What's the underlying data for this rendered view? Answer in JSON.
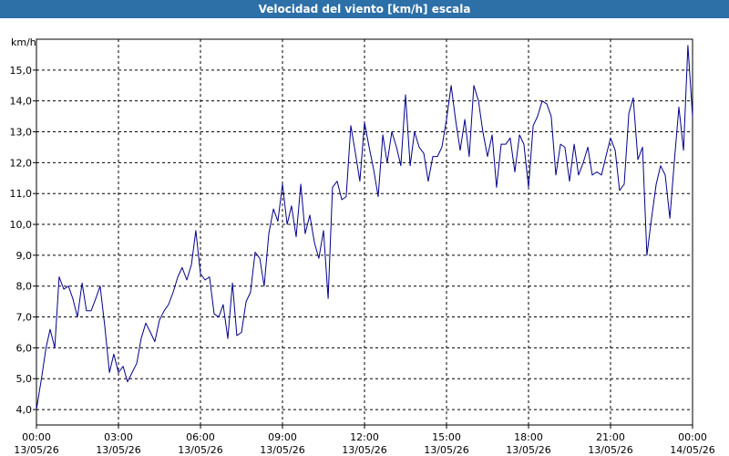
{
  "window": {
    "title": "Velocidad del viento [km/h] escala"
  },
  "chart_data": {
    "type": "line",
    "title": "Velocidad del viento [km/h] escala",
    "ylabel": "km/h",
    "xlabel": "",
    "ylim": [
      3.5,
      16.0
    ],
    "xlim_hours": [
      0,
      24
    ],
    "grid": true,
    "yticks": [
      {
        "value": 4.0,
        "label": "4,0"
      },
      {
        "value": 5.0,
        "label": "5,0"
      },
      {
        "value": 6.0,
        "label": "6,0"
      },
      {
        "value": 7.0,
        "label": "7,0"
      },
      {
        "value": 8.0,
        "label": "8,0"
      },
      {
        "value": 9.0,
        "label": "9,0"
      },
      {
        "value": 10.0,
        "label": "10,0"
      },
      {
        "value": 11.0,
        "label": "11,0"
      },
      {
        "value": 12.0,
        "label": "12,0"
      },
      {
        "value": 13.0,
        "label": "13,0"
      },
      {
        "value": 14.0,
        "label": "14,0"
      },
      {
        "value": 15.0,
        "label": "15,0"
      }
    ],
    "xticks": [
      {
        "hour": 0,
        "time": "00:00",
        "date": "13/05/26"
      },
      {
        "hour": 3,
        "time": "03:00",
        "date": "13/05/26"
      },
      {
        "hour": 6,
        "time": "06:00",
        "date": "13/05/26"
      },
      {
        "hour": 9,
        "time": "09:00",
        "date": "13/05/26"
      },
      {
        "hour": 12,
        "time": "12:00",
        "date": "13/05/26"
      },
      {
        "hour": 15,
        "time": "15:00",
        "date": "13/05/26"
      },
      {
        "hour": 18,
        "time": "18:00",
        "date": "13/05/26"
      },
      {
        "hour": 21,
        "time": "21:00",
        "date": "13/05/26"
      },
      {
        "hour": 24,
        "time": "00:00",
        "date": "14/05/26"
      }
    ],
    "series": [
      {
        "color": "#00008b",
        "points": [
          [
            0.0,
            4.0
          ],
          [
            0.2,
            5.1
          ],
          [
            0.35,
            6.0
          ],
          [
            0.5,
            6.6
          ],
          [
            0.67,
            6.0
          ],
          [
            0.83,
            8.3
          ],
          [
            1.0,
            7.9
          ],
          [
            1.17,
            8.0
          ],
          [
            1.33,
            7.6
          ],
          [
            1.5,
            7.0
          ],
          [
            1.67,
            8.1
          ],
          [
            1.83,
            7.2
          ],
          [
            2.0,
            7.2
          ],
          [
            2.17,
            7.6
          ],
          [
            2.33,
            8.0
          ],
          [
            2.5,
            6.7
          ],
          [
            2.67,
            5.2
          ],
          [
            2.83,
            5.8
          ],
          [
            3.0,
            5.2
          ],
          [
            3.17,
            5.4
          ],
          [
            3.33,
            4.9
          ],
          [
            3.5,
            5.2
          ],
          [
            3.67,
            5.5
          ],
          [
            3.83,
            6.3
          ],
          [
            4.0,
            6.8
          ],
          [
            4.17,
            6.5
          ],
          [
            4.33,
            6.2
          ],
          [
            4.5,
            6.9
          ],
          [
            4.67,
            7.2
          ],
          [
            4.83,
            7.4
          ],
          [
            5.0,
            7.8
          ],
          [
            5.17,
            8.3
          ],
          [
            5.33,
            8.6
          ],
          [
            5.5,
            8.2
          ],
          [
            5.67,
            8.7
          ],
          [
            5.83,
            9.8
          ],
          [
            6.0,
            8.4
          ],
          [
            6.17,
            8.2
          ],
          [
            6.33,
            8.3
          ],
          [
            6.5,
            7.1
          ],
          [
            6.67,
            7.0
          ],
          [
            6.83,
            7.4
          ],
          [
            7.0,
            6.3
          ],
          [
            7.17,
            8.1
          ],
          [
            7.33,
            6.4
          ],
          [
            7.5,
            6.5
          ],
          [
            7.67,
            7.5
          ],
          [
            7.83,
            7.8
          ],
          [
            8.0,
            9.1
          ],
          [
            8.17,
            8.9
          ],
          [
            8.33,
            8.0
          ],
          [
            8.5,
            9.7
          ],
          [
            8.67,
            10.5
          ],
          [
            8.83,
            10.1
          ],
          [
            9.0,
            11.3
          ],
          [
            9.17,
            10.0
          ],
          [
            9.33,
            10.6
          ],
          [
            9.5,
            9.6
          ],
          [
            9.67,
            11.3
          ],
          [
            9.83,
            9.7
          ],
          [
            10.0,
            10.3
          ],
          [
            10.17,
            9.4
          ],
          [
            10.33,
            8.9
          ],
          [
            10.5,
            9.8
          ],
          [
            10.67,
            7.6
          ],
          [
            10.83,
            11.2
          ],
          [
            11.0,
            11.4
          ],
          [
            11.17,
            10.8
          ],
          [
            11.33,
            10.9
          ],
          [
            11.5,
            13.2
          ],
          [
            11.67,
            12.3
          ],
          [
            11.83,
            11.4
          ],
          [
            12.0,
            13.3
          ],
          [
            12.17,
            12.5
          ],
          [
            12.33,
            11.8
          ],
          [
            12.5,
            10.9
          ],
          [
            12.67,
            12.9
          ],
          [
            12.83,
            12.0
          ],
          [
            13.0,
            13.0
          ],
          [
            13.17,
            12.5
          ],
          [
            13.33,
            11.9
          ],
          [
            13.5,
            14.2
          ],
          [
            13.67,
            11.9
          ],
          [
            13.83,
            13.0
          ],
          [
            14.0,
            12.5
          ],
          [
            14.17,
            12.3
          ],
          [
            14.33,
            11.4
          ],
          [
            14.5,
            12.2
          ],
          [
            14.67,
            12.2
          ],
          [
            14.83,
            12.5
          ],
          [
            15.0,
            13.4
          ],
          [
            15.17,
            14.5
          ],
          [
            15.33,
            13.4
          ],
          [
            15.5,
            12.4
          ],
          [
            15.67,
            13.4
          ],
          [
            15.83,
            12.2
          ],
          [
            16.0,
            14.5
          ],
          [
            16.17,
            14.0
          ],
          [
            16.33,
            13.0
          ],
          [
            16.5,
            12.2
          ],
          [
            16.67,
            12.9
          ],
          [
            16.83,
            11.2
          ],
          [
            17.0,
            12.6
          ],
          [
            17.17,
            12.6
          ],
          [
            17.33,
            12.8
          ],
          [
            17.5,
            11.7
          ],
          [
            17.67,
            12.9
          ],
          [
            17.83,
            12.6
          ],
          [
            18.0,
            11.2
          ],
          [
            18.17,
            13.2
          ],
          [
            18.33,
            13.5
          ],
          [
            18.5,
            14.0
          ],
          [
            18.67,
            13.9
          ],
          [
            18.83,
            13.5
          ],
          [
            19.0,
            11.6
          ],
          [
            19.17,
            12.6
          ],
          [
            19.33,
            12.5
          ],
          [
            19.5,
            11.4
          ],
          [
            19.67,
            12.6
          ],
          [
            19.83,
            11.6
          ],
          [
            20.0,
            12.0
          ],
          [
            20.17,
            12.5
          ],
          [
            20.33,
            11.6
          ],
          [
            20.5,
            11.7
          ],
          [
            20.67,
            11.6
          ],
          [
            20.83,
            12.2
          ],
          [
            21.0,
            12.8
          ],
          [
            21.17,
            12.4
          ],
          [
            21.33,
            11.1
          ],
          [
            21.5,
            11.3
          ],
          [
            21.67,
            13.6
          ],
          [
            21.83,
            14.1
          ],
          [
            22.0,
            12.1
          ],
          [
            22.17,
            12.5
          ],
          [
            22.33,
            9.0
          ],
          [
            22.5,
            10.2
          ],
          [
            22.67,
            11.3
          ],
          [
            22.83,
            11.9
          ],
          [
            23.0,
            11.6
          ],
          [
            23.17,
            10.2
          ],
          [
            23.33,
            12.0
          ],
          [
            23.5,
            13.8
          ],
          [
            23.67,
            12.4
          ],
          [
            23.83,
            15.8
          ],
          [
            24.0,
            13.5
          ]
        ]
      }
    ]
  }
}
